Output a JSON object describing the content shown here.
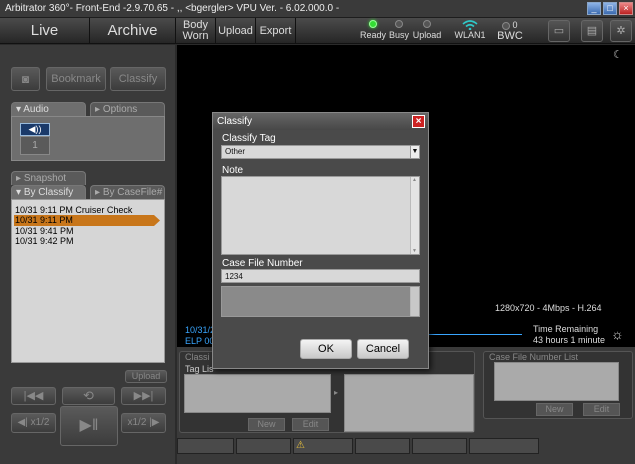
{
  "window": {
    "title": "Arbitrator 360°- Front-End -2.9.70.65 - ,, <bgergler>    VPU Ver. - 6.02.000.0 -",
    "min_glyph": "_",
    "max_glyph": "□",
    "close_glyph": "×"
  },
  "toolbar": {
    "live": "Live",
    "archive": "Archive",
    "body_worn_1": "Body",
    "body_worn_2": "Worn",
    "upload": "Upload",
    "export": "Export",
    "status": {
      "ready": "Ready",
      "busy": "Busy",
      "upload": "Upload",
      "wlan": "WLAN1",
      "bwc": "BWC",
      "bwc_count": "0"
    }
  },
  "left": {
    "bookmark": "Bookmark",
    "classify": "Classify",
    "audio_tab": "Audio",
    "options_tab": "Options",
    "audio_channel": "1",
    "snapshot_tab": "Snapshot",
    "by_classify_tab": "By Classify",
    "by_casefile_tab": "By CaseFile#",
    "classify_list": [
      "10/31 9:11 PM Cruiser Check",
      "10/31 9:11 PM",
      "10/31 9:41 PM",
      "10/31 9:42 PM"
    ],
    "selected_index": 1,
    "upload_btn": "Upload",
    "half_speed_back": "x1/2",
    "half_speed_fwd": "x1/2"
  },
  "video": {
    "resolution": "1280x720 - 4Mbps - H.264",
    "date_frag": "10/31/2",
    "elp_frag": "ELP 00:",
    "time_remaining_label": "Time Remaining",
    "time_remaining_value": "43 hours  1 minute"
  },
  "bottom": {
    "classify_group_frag": "Classi",
    "tag_list_frag": "Tag Lis",
    "new_btn": "New",
    "edit_btn": "Edit",
    "case_list_label": "Case File Number List",
    "case_new_btn": "New",
    "case_edit_btn": "Edit"
  },
  "dialog": {
    "title": "Classify",
    "close_glyph": "×",
    "classify_tag_label": "Classify Tag",
    "classify_tag_value": "Other",
    "note_label": "Note",
    "note_value": "",
    "case_label": "Case File Number",
    "case_value": "1234",
    "ok": "OK",
    "cancel": "Cancel"
  },
  "colors": {
    "selection": "#c8761a",
    "ready_led": "#33dd33",
    "wlan_icon": "#2fc9c9"
  }
}
